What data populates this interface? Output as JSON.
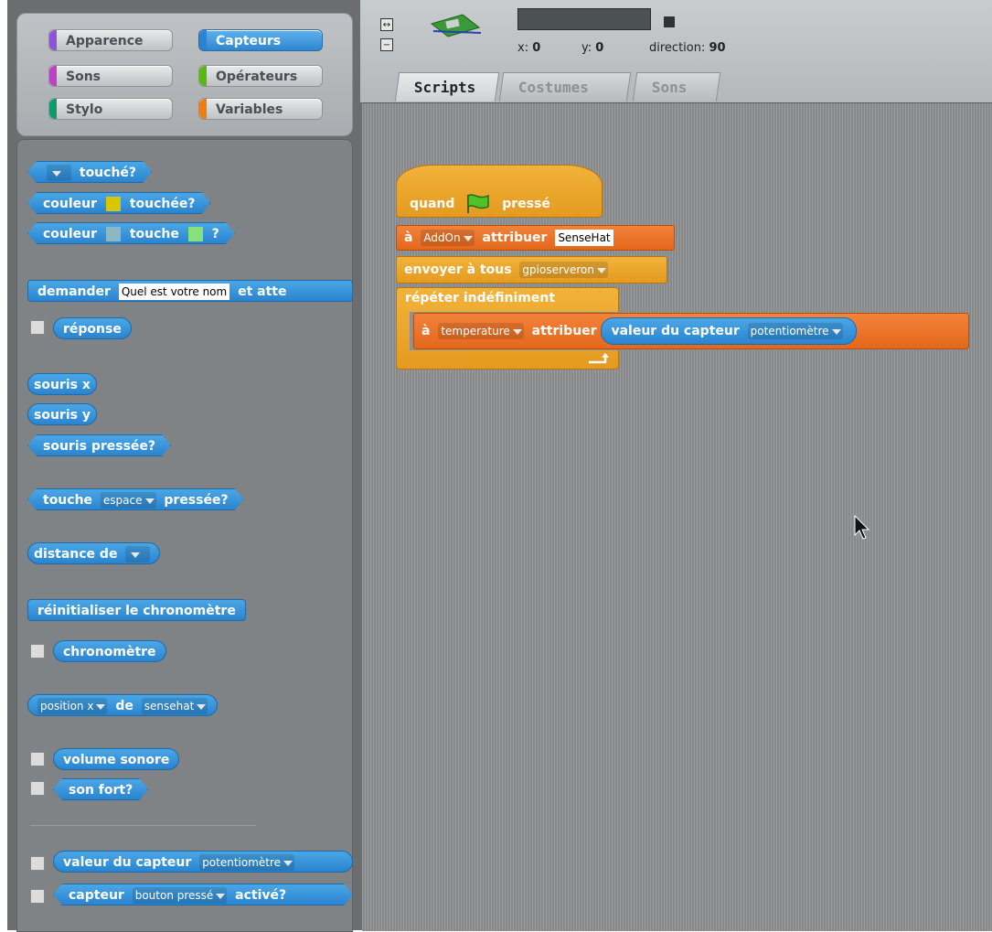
{
  "categories": [
    {
      "label": "Apparence",
      "color": "#8a55d7",
      "selected": false
    },
    {
      "label": "Capteurs",
      "color": "#2a84cf",
      "selected": true
    },
    {
      "label": "Sons",
      "color": "#bb42c3",
      "selected": false
    },
    {
      "label": "Opérateurs",
      "color": "#5cb712",
      "selected": false
    },
    {
      "label": "Stylo",
      "color": "#0e9a6c",
      "selected": false
    },
    {
      "label": "Variables",
      "color": "#ee7d16",
      "selected": false
    }
  ],
  "palette": {
    "touching": "touché?",
    "color_touching_a": "couleur",
    "color_touching_b": "touchée?",
    "color_color_a": "couleur",
    "color_color_b": "touche",
    "color_color_c": "?",
    "ask_a": "demander",
    "ask_value": "Quel est votre nom",
    "ask_b": "et atte",
    "answer": "réponse",
    "mouse_x": "souris x",
    "mouse_y": "souris y",
    "mouse_down": "souris pressée?",
    "key_a": "touche",
    "key_value": "espace",
    "key_b": "pressée?",
    "distance": "distance de",
    "reset_timer": "réinitialiser le chronomètre",
    "timer": "chronomètre",
    "attr_value": "position x",
    "attr_of": "de",
    "attr_obj": "sensehat",
    "loudness": "volume sonore",
    "loud": "son fort?",
    "sensor_value_a": "valeur du capteur",
    "sensor_value_dd": "potentiomètre",
    "sensor_a": "capteur",
    "sensor_dd": "bouton pressé",
    "sensor_b": "activé?"
  },
  "sprite": {
    "x_label": "x:",
    "x_value": "0",
    "y_label": "y:",
    "y_value": "0",
    "direction_label": "direction:",
    "direction_value": "90"
  },
  "tabs": [
    "Scripts",
    "Costumes",
    "Sons"
  ],
  "script": {
    "hat_a": "quand",
    "hat_b": "pressé",
    "set1_a": "à",
    "set1_var": "AddOn",
    "set1_b": "attribuer",
    "set1_value": "SenseHat",
    "broadcast_a": "envoyer à tous",
    "broadcast_value": "gpioserveron",
    "forever": "répéter indéfiniment",
    "set2_a": "à",
    "set2_var": "temperature",
    "set2_b": "attribuer",
    "reporter_a": "valeur du capteur",
    "reporter_dd": "potentiomètre"
  }
}
